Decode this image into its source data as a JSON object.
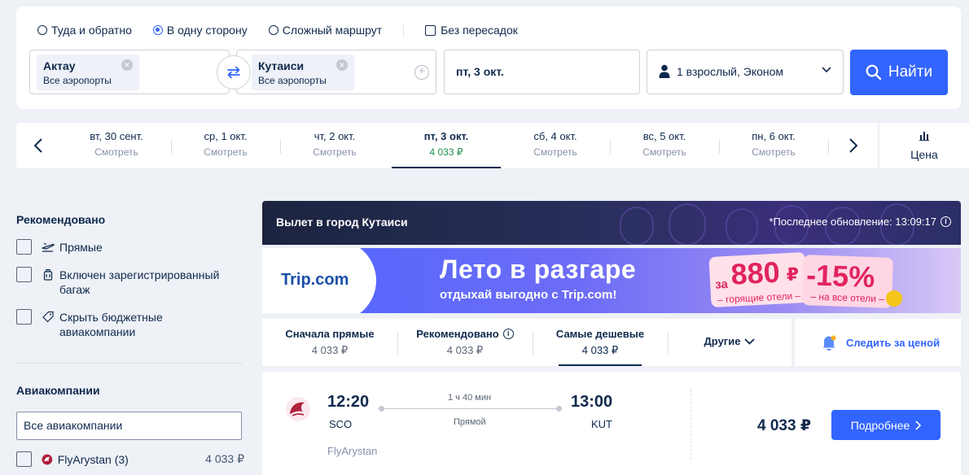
{
  "trip_types": [
    {
      "label": "Туда и обратно",
      "checked": false
    },
    {
      "label": "В одну сторону",
      "checked": true
    },
    {
      "label": "Сложный маршрут",
      "checked": false
    }
  ],
  "nonstop_label": "Без пересадок",
  "from": {
    "city": "Актау",
    "sub": "Все аэропорты"
  },
  "to": {
    "city": "Кутаиси",
    "sub": "Все аэропорты"
  },
  "date": "пт, 3 окт.",
  "passengers": "1 взрослый, Эконом",
  "search_label": "Найти",
  "dates": [
    {
      "day": "вт, 30 сент.",
      "price": "Смотреть"
    },
    {
      "day": "ср, 1 окт.",
      "price": "Смотреть"
    },
    {
      "day": "чт, 2 окт.",
      "price": "Смотреть"
    },
    {
      "day": "пт, 3 окт.",
      "price": "4 033 ₽"
    },
    {
      "day": "сб, 4 окт.",
      "price": "Смотреть"
    },
    {
      "day": "вс, 5 окт.",
      "price": "Смотреть"
    },
    {
      "day": "пн, 6 окт.",
      "price": "Смотреть"
    }
  ],
  "price_tab": "Цена",
  "filters": {
    "recommended_title": "Рекомендовано",
    "items": [
      {
        "label": "Прямые"
      },
      {
        "label": "Включен зарегистрированный багаж"
      },
      {
        "label": "Скрыть бюджетные авиакомпании"
      }
    ],
    "airlines_title": "Авиакомпании",
    "airlines_input": "Все авиакомпании",
    "airlines": [
      {
        "name": "FlyArystan (3)",
        "price": "4 033 ₽"
      }
    ]
  },
  "banner": {
    "title": "Вылет в город Кутаиси",
    "updated": "*Последнее обновление: 13:09:17"
  },
  "ad": {
    "logo": "Trip.com",
    "headline": "Лето в разгаре",
    "subline": "отдыхай выгодно с Trip.com!",
    "za": "за",
    "amount": "880",
    "rub": "₽",
    "hotels": "– горящие отели –",
    "discount": "-15%",
    "all_hotels": "– на все отели –"
  },
  "sort": [
    {
      "label": "Сначала прямые",
      "price": "4 033 ₽"
    },
    {
      "label": "Рекомендовано",
      "price": "4 033 ₽"
    },
    {
      "label": "Самые дешевые",
      "price": "4 033 ₽"
    },
    {
      "label": "Другие",
      "price": ""
    }
  ],
  "track_price": "Следить за ценой",
  "flight": {
    "dep_time": "12:20",
    "dep_code": "SCO",
    "arr_time": "13:00",
    "arr_code": "KUT",
    "duration": "1 ч 40 мин",
    "stops": "Прямой",
    "airline": "FlyArystan",
    "price": "4 033 ₽",
    "details": "Подробнее"
  },
  "colors": {
    "accent": "#3264ff",
    "text": "#0f294d",
    "price_green": "#1f8f52"
  }
}
